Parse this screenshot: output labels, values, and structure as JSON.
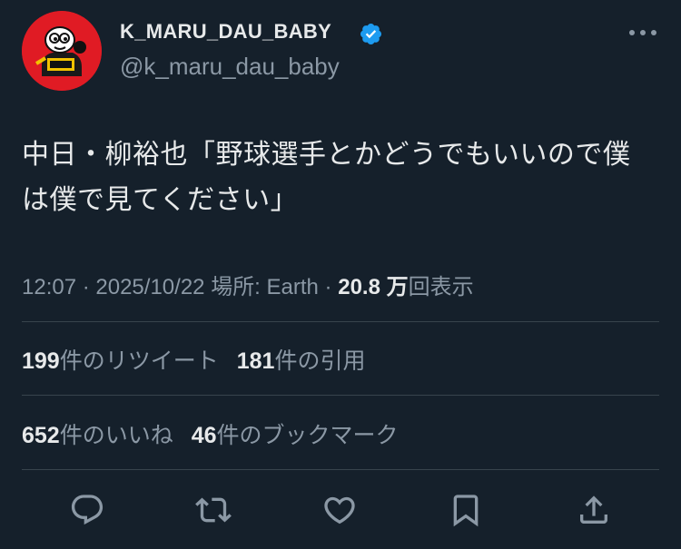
{
  "tweet": {
    "display_name": "K_MARU_DAU_BABY",
    "handle": "@k_maru_dau_baby",
    "verified": true,
    "text_line1": "中日・柳裕也「野球選手とかどうでもいいので僕",
    "text_line2": "は僕で見てください」",
    "time": "12:07",
    "sep": " · ",
    "date": "2025/10/22",
    "location": "場所: Earth",
    "views_count": "20.8 万",
    "views_label": "回表示"
  },
  "stats": {
    "retweets_count": "199",
    "retweets_label": "件のリツイート",
    "quotes_count": "181",
    "quotes_label": "件の引用",
    "likes_count": "652",
    "likes_label": "件のいいね",
    "bookmarks_count": "46",
    "bookmarks_label": "件のブックマーク"
  },
  "icons": {
    "avatar": "mascot-avatar",
    "verified": "verified-badge-icon",
    "more": "more-icon",
    "reply": "reply-icon",
    "retweet": "retweet-icon",
    "like": "like-icon",
    "bookmark": "bookmark-icon",
    "share": "share-icon"
  },
  "colors": {
    "background": "#15202b",
    "primary_text": "#e7e9ea",
    "secondary_text": "#8b98a5",
    "divider": "#38444d",
    "verified": "#1d9bf0",
    "avatar_red": "#e01b24"
  }
}
